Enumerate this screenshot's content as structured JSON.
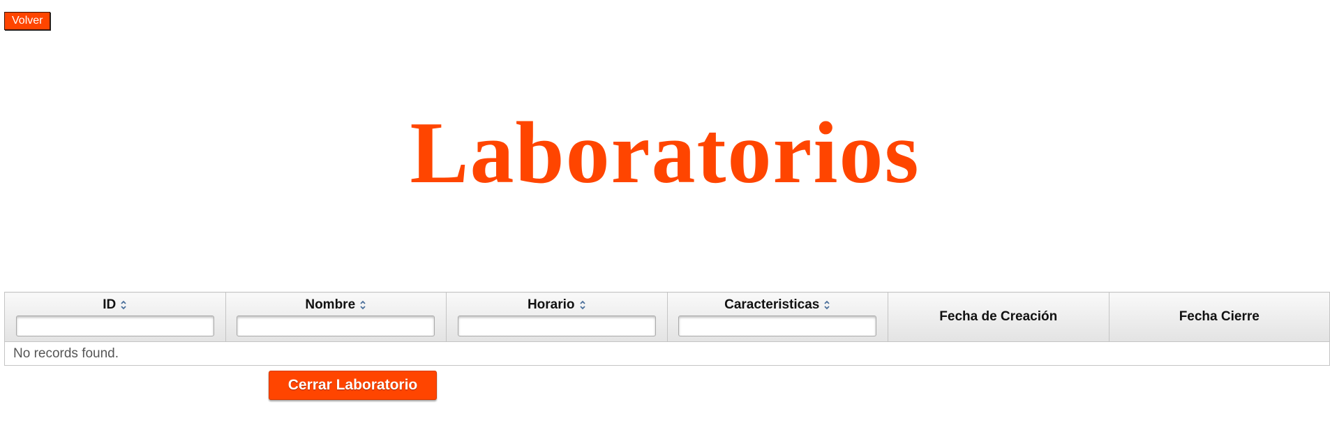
{
  "navigation": {
    "back_label": "Volver"
  },
  "page": {
    "title": "Laboratorios"
  },
  "table": {
    "columns": [
      {
        "label": "ID",
        "sortable": true,
        "filterable": true
      },
      {
        "label": "Nombre",
        "sortable": true,
        "filterable": true
      },
      {
        "label": "Horario",
        "sortable": true,
        "filterable": true
      },
      {
        "label": "Caracteristicas",
        "sortable": true,
        "filterable": true
      },
      {
        "label": "Fecha de Creación",
        "sortable": false,
        "filterable": false
      },
      {
        "label": "Fecha Cierre",
        "sortable": false,
        "filterable": false
      }
    ],
    "filters": [
      "",
      "",
      "",
      ""
    ],
    "empty_message": "No records found."
  },
  "actions": {
    "close_lab_label": "Cerrar Laboratorio"
  },
  "colors": {
    "accent": "#ff4500",
    "header_gradient_top": "#f9f9f9",
    "header_gradient_bottom": "#e3e3e3",
    "sort_icon": "#4a6f9a"
  },
  "icons": {
    "sort": "sort-up-down-icon"
  }
}
